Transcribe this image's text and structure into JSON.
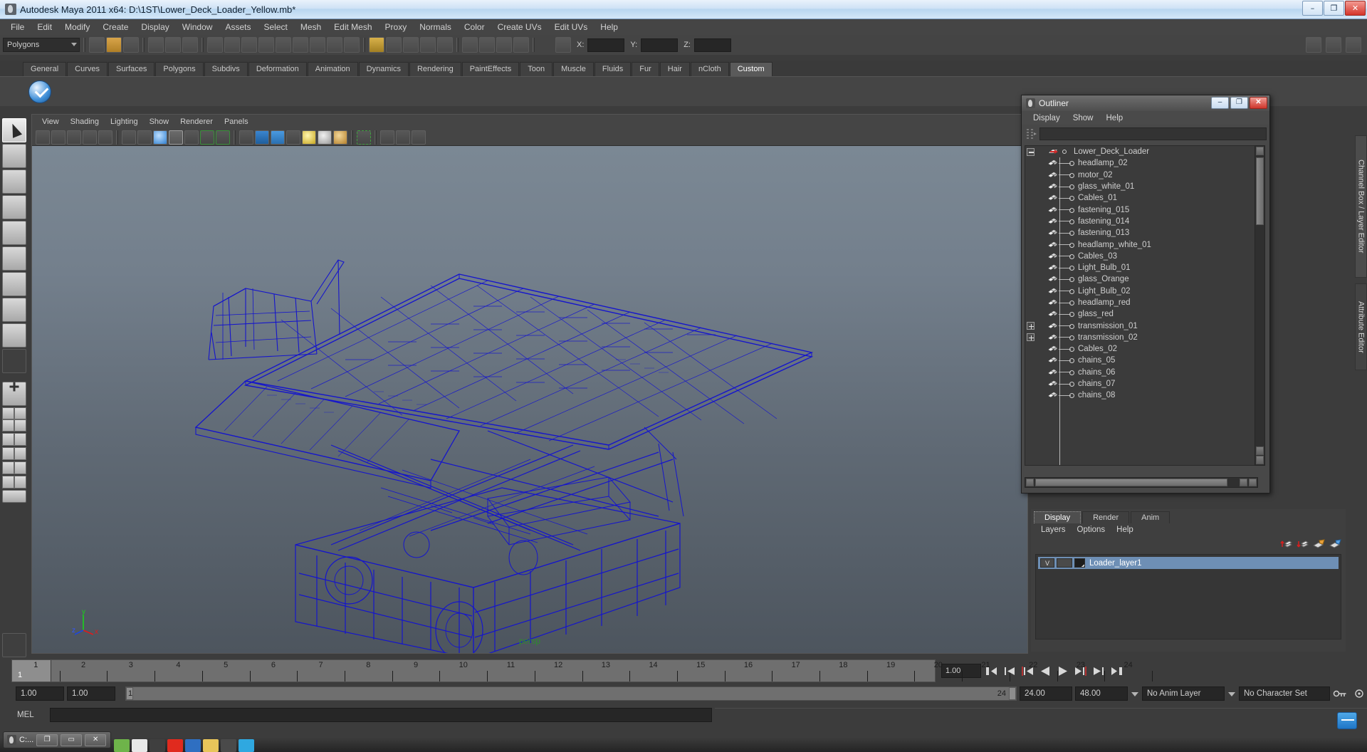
{
  "window": {
    "title": "Autodesk Maya 2011 x64: D:\\1ST\\Lower_Deck_Loader_Yellow.mb*",
    "app_icon": "maya-icon",
    "minimize_label": "–",
    "maximize_label": "❐",
    "close_label": "✕"
  },
  "menubar": {
    "items": [
      "File",
      "Edit",
      "Modify",
      "Create",
      "Display",
      "Window",
      "Assets",
      "Select",
      "Mesh",
      "Edit Mesh",
      "Proxy",
      "Normals",
      "Color",
      "Create UVs",
      "Edit UVs",
      "Help"
    ]
  },
  "statusline": {
    "selection_mode": "Polygons",
    "x_label": "X:",
    "y_label": "Y:",
    "z_label": "Z:",
    "x_value": "",
    "y_value": "",
    "z_value": ""
  },
  "shelf": {
    "tabs": [
      "General",
      "Curves",
      "Surfaces",
      "Polygons",
      "Subdivs",
      "Deformation",
      "Animation",
      "Dynamics",
      "Rendering",
      "PaintEffects",
      "Toon",
      "Muscle",
      "Fluids",
      "Fur",
      "Hair",
      "nCloth",
      "Custom"
    ],
    "active_tab": "Custom",
    "active_icon": "checkmark-sphere-icon"
  },
  "toolbox": {
    "tools": [
      "select-tool",
      "lasso-select-tool",
      "paint-select-tool",
      "move-tool",
      "rotate-tool",
      "scale-tool",
      "universal-manipulator-tool",
      "soft-modification-tool",
      "last-tool-used"
    ]
  },
  "viewport": {
    "menus": [
      "View",
      "Shading",
      "Lighting",
      "Show",
      "Renderer",
      "Panels"
    ],
    "camera_label": "persp",
    "axis": {
      "x": "x",
      "y": "y",
      "z": "z"
    },
    "toolbar_icons": [
      "select-camera-icon",
      "camera-attributes-icon",
      "bookmark-icon",
      "image-plane-icon",
      "keyframe-icon",
      "xray-icon",
      "film-gate-icon",
      "resolution-gate-icon",
      "gate-mask-icon",
      "field-chart-icon",
      "safe-action-icon",
      "safe-title-icon",
      "wireframe-icon",
      "smooth-shade-icon",
      "smooth-shade-all-icon",
      "textured-icon",
      "light-icon-1",
      "light-icon-2",
      "light-icon-3",
      "isolate-select-icon",
      "xray-joints-icon",
      "xray-active-icon",
      "exposure-icon"
    ],
    "model_name": "Lower_Deck_Loader wireframe",
    "wire_color": "#1515cc"
  },
  "outliner": {
    "title": "Outliner",
    "menus": [
      "Display",
      "Show",
      "Help"
    ],
    "search_value": "",
    "search_icon": "filter-icon",
    "window_buttons": {
      "minimize": "–",
      "maximize": "❐",
      "close": "✕"
    },
    "items": [
      {
        "name": "Lower_Deck_Loader",
        "depth": 0,
        "expander": "minus",
        "icon": "transform-icon"
      },
      {
        "name": "headlamp_02",
        "depth": 1,
        "expander": "none",
        "icon": "mesh-icon"
      },
      {
        "name": "motor_02",
        "depth": 1,
        "expander": "none",
        "icon": "mesh-icon"
      },
      {
        "name": "glass_white_01",
        "depth": 1,
        "expander": "none",
        "icon": "mesh-icon"
      },
      {
        "name": "Cables_01",
        "depth": 1,
        "expander": "none",
        "icon": "mesh-icon"
      },
      {
        "name": "fastening_015",
        "depth": 1,
        "expander": "none",
        "icon": "mesh-icon"
      },
      {
        "name": "fastening_014",
        "depth": 1,
        "expander": "none",
        "icon": "mesh-icon"
      },
      {
        "name": "fastening_013",
        "depth": 1,
        "expander": "none",
        "icon": "mesh-icon"
      },
      {
        "name": "headlamp_white_01",
        "depth": 1,
        "expander": "none",
        "icon": "mesh-icon"
      },
      {
        "name": "Cables_03",
        "depth": 1,
        "expander": "none",
        "icon": "mesh-icon"
      },
      {
        "name": "Light_Bulb_01",
        "depth": 1,
        "expander": "none",
        "icon": "mesh-icon"
      },
      {
        "name": "glass_Orange",
        "depth": 1,
        "expander": "none",
        "icon": "mesh-icon"
      },
      {
        "name": "Light_Bulb_02",
        "depth": 1,
        "expander": "none",
        "icon": "mesh-icon"
      },
      {
        "name": "headlamp_red",
        "depth": 1,
        "expander": "none",
        "icon": "mesh-icon"
      },
      {
        "name": "glass_red",
        "depth": 1,
        "expander": "none",
        "icon": "mesh-icon"
      },
      {
        "name": "transmission_01",
        "depth": 1,
        "expander": "plus",
        "icon": "mesh-icon"
      },
      {
        "name": "transmission_02",
        "depth": 1,
        "expander": "plus",
        "icon": "mesh-icon"
      },
      {
        "name": "Cables_02",
        "depth": 1,
        "expander": "none",
        "icon": "mesh-icon"
      },
      {
        "name": "chains_05",
        "depth": 1,
        "expander": "none",
        "icon": "mesh-icon"
      },
      {
        "name": "chains_06",
        "depth": 1,
        "expander": "none",
        "icon": "mesh-icon"
      },
      {
        "name": "chains_07",
        "depth": 1,
        "expander": "none",
        "icon": "mesh-icon"
      },
      {
        "name": "chains_08",
        "depth": 1,
        "expander": "none",
        "icon": "mesh-icon"
      }
    ]
  },
  "layer_editor": {
    "tabs": [
      "Display",
      "Render",
      "Anim"
    ],
    "active_tab": "Display",
    "menus": [
      "Layers",
      "Options",
      "Help"
    ],
    "toolbar_icons": [
      "move-layer-up-icon",
      "move-layer-down-icon",
      "new-layer-icon",
      "new-layer-from-selected-icon"
    ],
    "layers": [
      {
        "visibility": "V",
        "playback": "",
        "name": "Loader_layer1",
        "selected": true,
        "color": "#6e8fb5"
      }
    ]
  },
  "right_tabs": [
    {
      "label": "Channel Box / Layer Editor",
      "active": true
    },
    {
      "label": "Attribute Editor",
      "active": false
    }
  ],
  "timeline": {
    "ticks": [
      1,
      2,
      3,
      4,
      5,
      6,
      7,
      8,
      9,
      10,
      11,
      12,
      13,
      14,
      15,
      16,
      17,
      18,
      19,
      20,
      21,
      22,
      23,
      24
    ],
    "current_frame": "1",
    "current_frame_field": "1.00",
    "playback_buttons": [
      "go-to-start-icon",
      "step-back-frame-icon",
      "step-back-key-icon",
      "play-backwards-icon",
      "play-forwards-icon",
      "step-forward-key-icon",
      "step-forward-frame-icon",
      "go-to-end-icon"
    ]
  },
  "range_slider": {
    "anim_start": "1.00",
    "range_start": "1.00",
    "bar_start": "1",
    "bar_end": "24",
    "range_end": "24.00",
    "anim_end": "48.00",
    "anim_layer": "No Anim Layer",
    "character_set": "No Character Set",
    "key_icon": "auto-key-icon",
    "prefs_icon": "animation-preferences-icon"
  },
  "command_line": {
    "label": "MEL",
    "value": "",
    "placeholder": ""
  },
  "taskbar": {
    "minimized_window": {
      "title": "C:...",
      "restore_label": "❐",
      "maximize_label": "▭",
      "close_label": "✕"
    },
    "app_icons": [
      "#6eb44a",
      "#e8e8e8",
      "#3f3f3f",
      "#e02a1e",
      "#2f6fc1",
      "#e8c55a",
      "#4a4a4a",
      "#2fa8e0"
    ]
  }
}
